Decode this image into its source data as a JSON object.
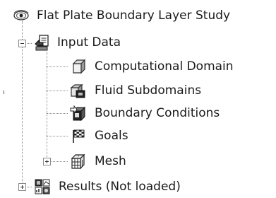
{
  "tree": {
    "root": {
      "label": "Flat Plate Boundary Layer Study",
      "icon": "study-eye-icon"
    },
    "input_data": {
      "label": "Input Data",
      "icon": "input-data-icon",
      "expanded": true
    },
    "children": [
      {
        "label": "Computational Domain",
        "icon": "computational-domain-icon"
      },
      {
        "label": "Fluid Subdomains",
        "icon": "fluid-subdomains-icon"
      },
      {
        "label": "Boundary Conditions",
        "icon": "boundary-conditions-icon"
      },
      {
        "label": "Goals",
        "icon": "goals-flag-icon"
      },
      {
        "label": "Mesh",
        "icon": "mesh-icon",
        "expandable": true
      }
    ],
    "results": {
      "label": "Results (Not loaded)",
      "icon": "results-icon",
      "expandable": true
    }
  }
}
